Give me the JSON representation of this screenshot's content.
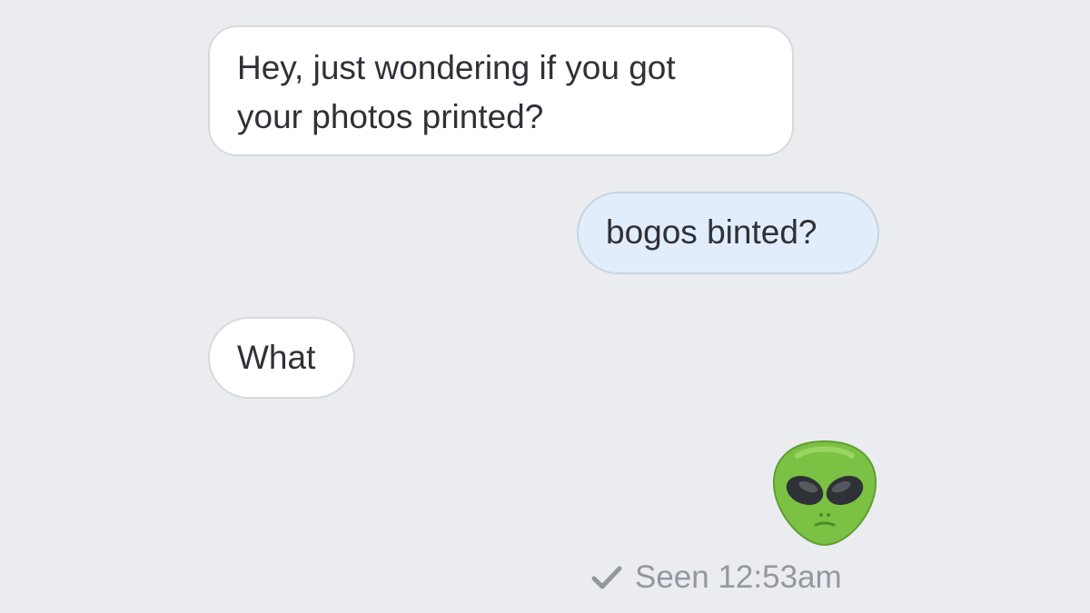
{
  "messages": [
    {
      "direction": "incoming",
      "text": "Hey, just wondering if you got\nyour photos printed?"
    },
    {
      "direction": "outgoing",
      "text": "bogos binted?"
    },
    {
      "direction": "incoming",
      "text": "What"
    }
  ],
  "reaction": {
    "icon": "alien-emoji-icon"
  },
  "receipt": {
    "icon": "checkmark-icon",
    "text": "Seen 12:53am"
  },
  "colors": {
    "background": "#ebecf0",
    "incoming_bubble": "#ffffff",
    "outgoing_bubble": "#e2edfb",
    "alien_green": "#7bc143",
    "receipt_text": "#9298a0"
  }
}
